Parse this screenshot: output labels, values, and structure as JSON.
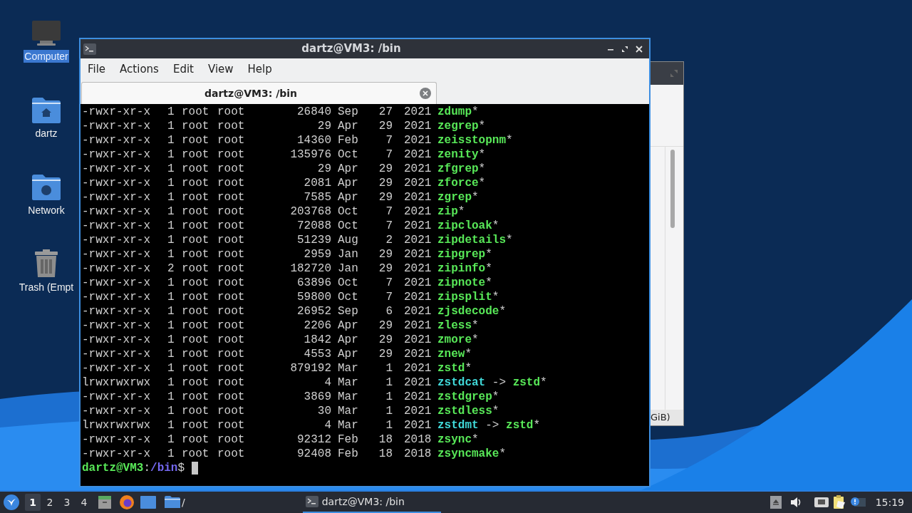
{
  "desktop_icons": [
    {
      "label": "Computer",
      "kind": "computer",
      "selected": true
    },
    {
      "label": "dartz",
      "kind": "home",
      "selected": false
    },
    {
      "label": "Network",
      "kind": "network",
      "selected": false
    },
    {
      "label": "Trash (Empt",
      "kind": "trash",
      "selected": false
    }
  ],
  "background_window": {
    "status_text": "GiB)"
  },
  "window": {
    "title": "dartz@VM3: /bin",
    "menu": [
      "File",
      "Actions",
      "Edit",
      "View",
      "Help"
    ],
    "tabs": [
      {
        "label": "dartz@VM3: /bin",
        "selected": true
      }
    ],
    "rows": [
      {
        "perm": "-rwxr-xr-x",
        "n": "1",
        "owner": "root",
        "group": "root",
        "size": "26840",
        "mon": "Sep",
        "day": "27",
        "year": "2021",
        "name": "zdump",
        "kind": "exec",
        "mark": "*"
      },
      {
        "perm": "-rwxr-xr-x",
        "n": "1",
        "owner": "root",
        "group": "root",
        "size": "29",
        "mon": "Apr",
        "day": "29",
        "year": "2021",
        "name": "zegrep",
        "kind": "exec",
        "mark": "*"
      },
      {
        "perm": "-rwxr-xr-x",
        "n": "1",
        "owner": "root",
        "group": "root",
        "size": "14360",
        "mon": "Feb",
        "day": "7",
        "year": "2021",
        "name": "zeisstopnm",
        "kind": "exec",
        "mark": "*"
      },
      {
        "perm": "-rwxr-xr-x",
        "n": "1",
        "owner": "root",
        "group": "root",
        "size": "135976",
        "mon": "Oct",
        "day": "7",
        "year": "2021",
        "name": "zenity",
        "kind": "exec",
        "mark": "*"
      },
      {
        "perm": "-rwxr-xr-x",
        "n": "1",
        "owner": "root",
        "group": "root",
        "size": "29",
        "mon": "Apr",
        "day": "29",
        "year": "2021",
        "name": "zfgrep",
        "kind": "exec",
        "mark": "*"
      },
      {
        "perm": "-rwxr-xr-x",
        "n": "1",
        "owner": "root",
        "group": "root",
        "size": "2081",
        "mon": "Apr",
        "day": "29",
        "year": "2021",
        "name": "zforce",
        "kind": "exec",
        "mark": "*"
      },
      {
        "perm": "-rwxr-xr-x",
        "n": "1",
        "owner": "root",
        "group": "root",
        "size": "7585",
        "mon": "Apr",
        "day": "29",
        "year": "2021",
        "name": "zgrep",
        "kind": "exec",
        "mark": "*"
      },
      {
        "perm": "-rwxr-xr-x",
        "n": "1",
        "owner": "root",
        "group": "root",
        "size": "203768",
        "mon": "Oct",
        "day": "7",
        "year": "2021",
        "name": "zip",
        "kind": "exec",
        "mark": "*"
      },
      {
        "perm": "-rwxr-xr-x",
        "n": "1",
        "owner": "root",
        "group": "root",
        "size": "72088",
        "mon": "Oct",
        "day": "7",
        "year": "2021",
        "name": "zipcloak",
        "kind": "exec",
        "mark": "*"
      },
      {
        "perm": "-rwxr-xr-x",
        "n": "1",
        "owner": "root",
        "group": "root",
        "size": "51239",
        "mon": "Aug",
        "day": "2",
        "year": "2021",
        "name": "zipdetails",
        "kind": "exec",
        "mark": "*"
      },
      {
        "perm": "-rwxr-xr-x",
        "n": "1",
        "owner": "root",
        "group": "root",
        "size": "2959",
        "mon": "Jan",
        "day": "29",
        "year": "2021",
        "name": "zipgrep",
        "kind": "exec",
        "mark": "*"
      },
      {
        "perm": "-rwxr-xr-x",
        "n": "2",
        "owner": "root",
        "group": "root",
        "size": "182720",
        "mon": "Jan",
        "day": "29",
        "year": "2021",
        "name": "zipinfo",
        "kind": "exec",
        "mark": "*"
      },
      {
        "perm": "-rwxr-xr-x",
        "n": "1",
        "owner": "root",
        "group": "root",
        "size": "63896",
        "mon": "Oct",
        "day": "7",
        "year": "2021",
        "name": "zipnote",
        "kind": "exec",
        "mark": "*"
      },
      {
        "perm": "-rwxr-xr-x",
        "n": "1",
        "owner": "root",
        "group": "root",
        "size": "59800",
        "mon": "Oct",
        "day": "7",
        "year": "2021",
        "name": "zipsplit",
        "kind": "exec",
        "mark": "*"
      },
      {
        "perm": "-rwxr-xr-x",
        "n": "1",
        "owner": "root",
        "group": "root",
        "size": "26952",
        "mon": "Sep",
        "day": "6",
        "year": "2021",
        "name": "zjsdecode",
        "kind": "exec",
        "mark": "*"
      },
      {
        "perm": "-rwxr-xr-x",
        "n": "1",
        "owner": "root",
        "group": "root",
        "size": "2206",
        "mon": "Apr",
        "day": "29",
        "year": "2021",
        "name": "zless",
        "kind": "exec",
        "mark": "*"
      },
      {
        "perm": "-rwxr-xr-x",
        "n": "1",
        "owner": "root",
        "group": "root",
        "size": "1842",
        "mon": "Apr",
        "day": "29",
        "year": "2021",
        "name": "zmore",
        "kind": "exec",
        "mark": "*"
      },
      {
        "perm": "-rwxr-xr-x",
        "n": "1",
        "owner": "root",
        "group": "root",
        "size": "4553",
        "mon": "Apr",
        "day": "29",
        "year": "2021",
        "name": "znew",
        "kind": "exec",
        "mark": "*"
      },
      {
        "perm": "-rwxr-xr-x",
        "n": "1",
        "owner": "root",
        "group": "root",
        "size": "879192",
        "mon": "Mar",
        "day": "1",
        "year": "2021",
        "name": "zstd",
        "kind": "exec",
        "mark": "*"
      },
      {
        "perm": "lrwxrwxrwx",
        "n": "1",
        "owner": "root",
        "group": "root",
        "size": "4",
        "mon": "Mar",
        "day": "1",
        "year": "2021",
        "name": "zstdcat",
        "kind": "link",
        "arrow": "->",
        "target": "zstd",
        "mark": "*"
      },
      {
        "perm": "-rwxr-xr-x",
        "n": "1",
        "owner": "root",
        "group": "root",
        "size": "3869",
        "mon": "Mar",
        "day": "1",
        "year": "2021",
        "name": "zstdgrep",
        "kind": "exec",
        "mark": "*"
      },
      {
        "perm": "-rwxr-xr-x",
        "n": "1",
        "owner": "root",
        "group": "root",
        "size": "30",
        "mon": "Mar",
        "day": "1",
        "year": "2021",
        "name": "zstdless",
        "kind": "exec",
        "mark": "*"
      },
      {
        "perm": "lrwxrwxrwx",
        "n": "1",
        "owner": "root",
        "group": "root",
        "size": "4",
        "mon": "Mar",
        "day": "1",
        "year": "2021",
        "name": "zstdmt",
        "kind": "link",
        "arrow": "->",
        "target": "zstd",
        "mark": "*"
      },
      {
        "perm": "-rwxr-xr-x",
        "n": "1",
        "owner": "root",
        "group": "root",
        "size": "92312",
        "mon": "Feb",
        "day": "18",
        "year": "2018",
        "name": "zsync",
        "kind": "exec",
        "mark": "*"
      },
      {
        "perm": "-rwxr-xr-x",
        "n": "1",
        "owner": "root",
        "group": "root",
        "size": "92408",
        "mon": "Feb",
        "day": "18",
        "year": "2018",
        "name": "zsyncmake",
        "kind": "exec",
        "mark": "*"
      }
    ],
    "prompt": {
      "user_host": "dartz@VM3",
      "separator": ":",
      "path": "/bin",
      "symbol": "$"
    }
  },
  "taskbar": {
    "workspaces": [
      {
        "label": "1",
        "selected": true
      },
      {
        "label": "2",
        "selected": false
      },
      {
        "label": "3",
        "selected": false
      },
      {
        "label": "4",
        "selected": false
      }
    ],
    "folder_label": "/",
    "tasks": [
      {
        "label": "dartz@VM3: /bin",
        "selected": true
      }
    ],
    "clock": "15:19"
  }
}
